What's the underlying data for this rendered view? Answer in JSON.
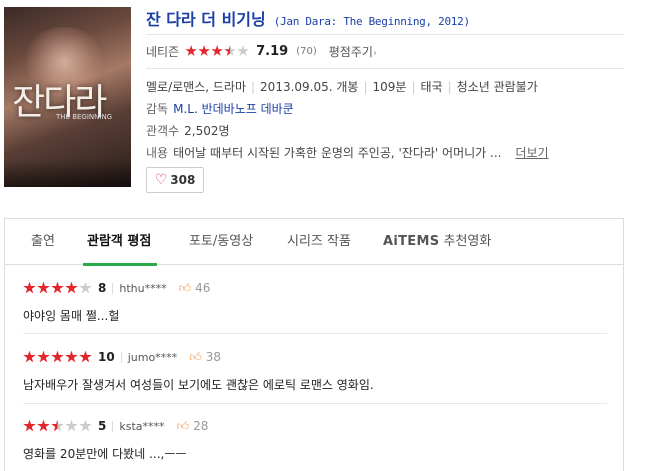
{
  "poster": {
    "title_art": "잔다라",
    "subtitle_art": "THE BEGINNING"
  },
  "movie": {
    "title": "잔 다라 더 비기닝",
    "original": "(Jan Dara: The Beginning, 2012)",
    "netizen_label": "네티즌",
    "rating_stars": 3.5,
    "score": "7.19",
    "rating_count": "(70)",
    "rate_link": "평점주기",
    "genre": "멜로/로맨스, 드라마",
    "release": "2013.09.05. 개봉",
    "runtime": "109분",
    "country": "태국",
    "age": "청소년 관람불가",
    "director_label": "감독",
    "director": "M.L. 반데바노프 데바쿤",
    "audience_label": "관객수",
    "audience": "2,502명",
    "synopsis_label": "내용",
    "synopsis": "태어날 때부터 시작된 가혹한 운명의 주인공, '잔다라' 어머니가 ...",
    "more_label": "더보기",
    "likes": "308"
  },
  "tabs": [
    {
      "label": "출연",
      "active": false
    },
    {
      "label": "관람객 평점",
      "active": true
    },
    {
      "label": "포토/동영상",
      "active": false
    },
    {
      "label": "시리즈 작품",
      "active": false
    },
    {
      "label_brand": "AiTEMS",
      "label": "추천영화",
      "active": false
    }
  ],
  "reviews": [
    {
      "stars": 4,
      "score": "8",
      "user": "hthu****",
      "likes": "46",
      "text": "야야잉 몸매 쩔...헐"
    },
    {
      "stars": 5,
      "score": "10",
      "user": "jumo****",
      "likes": "38",
      "text": "남자배우가 잘생겨서 여성들이 보기에도 괜찮은 에로틱 로맨스 영화임."
    },
    {
      "stars": 2.5,
      "score": "5",
      "user": "ksta****",
      "likes": "28",
      "text": "영화를 20분만에 다봤네 ...,ㅡㅡ"
    }
  ],
  "colors": {
    "accent_blue": "#1b3fa6",
    "star_red": "#e2262c",
    "tab_green": "#2ba84a"
  }
}
